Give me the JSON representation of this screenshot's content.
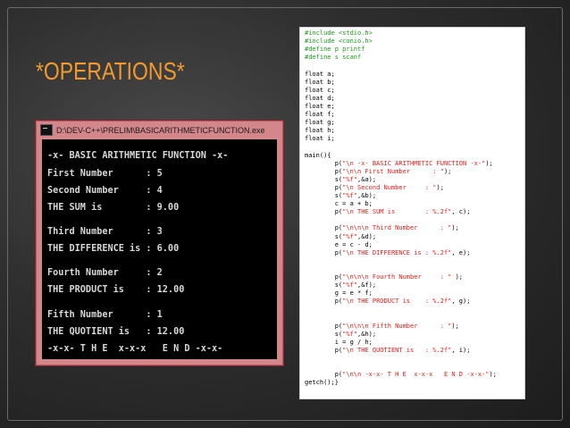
{
  "slide": {
    "title": "*OPERATIONS*",
    "title_color": "#f29a2e",
    "background": "#2e2e2e"
  },
  "console": {
    "window_title": "D:\\DEV-C++\\PRELIM\\BASICARITHMETICFUNCTION.exe",
    "lines": [
      "-x- BASIC ARITHMETIC FUNCTION -x-",
      "First Number      : 5",
      "Second Number     : 4",
      "THE SUM is        : 9.00",
      "Third Number      : 3",
      "THE DIFFERENCE is : 6.00",
      "Fourth Number     : 2",
      "THE PRODUCT is    : 12.00",
      "Fifth Number      : 1",
      "THE QUOTIENT is   : 12.00",
      "-x-x- T H E  x-x-x   E N D -x-x-"
    ]
  },
  "code": {
    "lines": [
      [
        {
          "t": "#include <stdio.h>",
          "c": "dir"
        }
      ],
      [
        {
          "t": "#include <conio.h>",
          "c": "dir"
        }
      ],
      [
        {
          "t": "#define p printf",
          "c": "dir"
        }
      ],
      [
        {
          "t": "#define s scanf",
          "c": "dir"
        }
      ],
      [],
      [
        {
          "t": "float a;",
          "c": "txt"
        }
      ],
      [
        {
          "t": "float b;",
          "c": "txt"
        }
      ],
      [
        {
          "t": "float c;",
          "c": "txt"
        }
      ],
      [
        {
          "t": "float d;",
          "c": "txt"
        }
      ],
      [
        {
          "t": "float e;",
          "c": "txt"
        }
      ],
      [
        {
          "t": "float f;",
          "c": "txt"
        }
      ],
      [
        {
          "t": "float g;",
          "c": "txt"
        }
      ],
      [
        {
          "t": "float h;",
          "c": "txt"
        }
      ],
      [
        {
          "t": "float i;",
          "c": "txt"
        }
      ],
      [],
      [
        {
          "t": "main(){",
          "c": "txt"
        }
      ],
      [
        {
          "t": "        p(",
          "c": "txt"
        },
        {
          "t": "\"\\n -x- BASIC ARITHMETIC FUNCTION -x-\"",
          "c": "str"
        },
        {
          "t": ");",
          "c": "txt"
        }
      ],
      [
        {
          "t": "        p(",
          "c": "txt"
        },
        {
          "t": "\"\\n\\n First Number      : \"",
          "c": "str"
        },
        {
          "t": ");",
          "c": "txt"
        }
      ],
      [
        {
          "t": "        s(",
          "c": "txt"
        },
        {
          "t": "\"%f\"",
          "c": "str"
        },
        {
          "t": ",&a);",
          "c": "txt"
        }
      ],
      [
        {
          "t": "        p(",
          "c": "txt"
        },
        {
          "t": "\"\\n Second Number     : \"",
          "c": "str"
        },
        {
          "t": ");",
          "c": "txt"
        }
      ],
      [
        {
          "t": "        s(",
          "c": "txt"
        },
        {
          "t": "\"%f\"",
          "c": "str"
        },
        {
          "t": ",&b);",
          "c": "txt"
        }
      ],
      [
        {
          "t": "        c = a + b;",
          "c": "txt"
        }
      ],
      [
        {
          "t": "        p(",
          "c": "txt"
        },
        {
          "t": "\"\\n THE SUM is        : %.2f\"",
          "c": "str"
        },
        {
          "t": ", c);",
          "c": "txt"
        }
      ],
      [],
      [
        {
          "t": "        p(",
          "c": "txt"
        },
        {
          "t": "\"\\n\\n\\n Third Number      : \"",
          "c": "str"
        },
        {
          "t": ");",
          "c": "txt"
        }
      ],
      [
        {
          "t": "        s(",
          "c": "txt"
        },
        {
          "t": "\"%f\"",
          "c": "str"
        },
        {
          "t": ",&d);",
          "c": "txt"
        }
      ],
      [
        {
          "t": "        e = c - d;",
          "c": "txt"
        }
      ],
      [
        {
          "t": "        p(",
          "c": "txt"
        },
        {
          "t": "\"\\n THE DIFFERENCE is : %.2f\"",
          "c": "str"
        },
        {
          "t": ", e);",
          "c": "txt"
        }
      ],
      [],
      [],
      [
        {
          "t": "        p(",
          "c": "txt"
        },
        {
          "t": "\"\\n\\n\\n Fourth Number     : \"",
          "c": "str"
        },
        {
          "t": " );",
          "c": "txt"
        }
      ],
      [
        {
          "t": "        s(",
          "c": "txt"
        },
        {
          "t": "\"%f\"",
          "c": "str"
        },
        {
          "t": ",&f);",
          "c": "txt"
        }
      ],
      [
        {
          "t": "        g = e * f;",
          "c": "txt"
        }
      ],
      [
        {
          "t": "        p(",
          "c": "txt"
        },
        {
          "t": "\"\\n THE PRODUCT is    : %.2f\"",
          "c": "str"
        },
        {
          "t": ", g);",
          "c": "txt"
        }
      ],
      [],
      [],
      [
        {
          "t": "        p(",
          "c": "txt"
        },
        {
          "t": "\"\\n\\n\\n Fifth Number      : \"",
          "c": "str"
        },
        {
          "t": ");",
          "c": "txt"
        }
      ],
      [
        {
          "t": "        s(",
          "c": "txt"
        },
        {
          "t": "\"%f\"",
          "c": "str"
        },
        {
          "t": ",&h);",
          "c": "txt"
        }
      ],
      [
        {
          "t": "        i = g / h;",
          "c": "txt"
        }
      ],
      [
        {
          "t": "        p(",
          "c": "txt"
        },
        {
          "t": "\"\\n THE QUOTIENT is   : %.2f\"",
          "c": "str"
        },
        {
          "t": ", i);",
          "c": "txt"
        }
      ],
      [],
      [],
      [
        {
          "t": "        p(",
          "c": "txt"
        },
        {
          "t": "\"\\n\\n -x-x- T H E  x-x-x   E N D -x-x-\"",
          "c": "str"
        },
        {
          "t": ");",
          "c": "txt"
        }
      ],
      [
        {
          "t": "getch();}",
          "c": "txt"
        }
      ]
    ],
    "colors": {
      "dir": "#1a9a1a",
      "str": "#e0201a",
      "txt": "#000000"
    }
  }
}
